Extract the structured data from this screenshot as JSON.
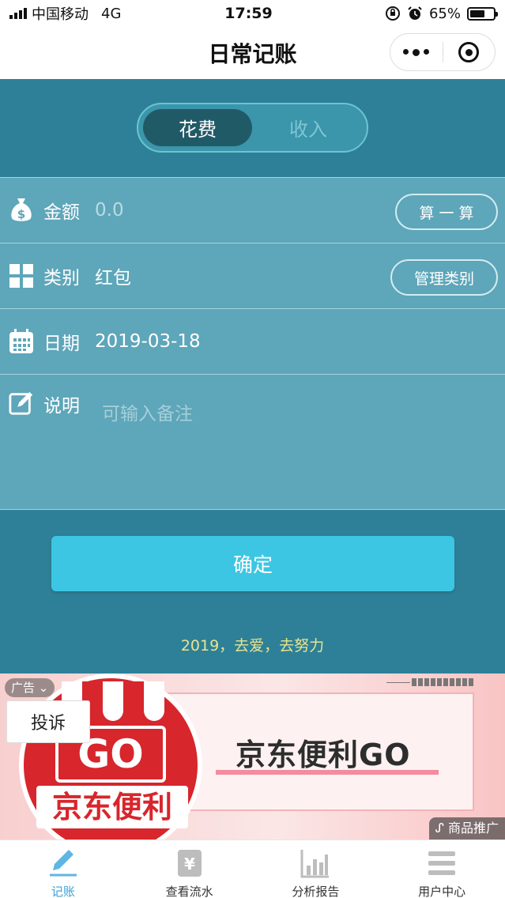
{
  "status_bar": {
    "carrier": "中国移动",
    "network": "4G",
    "time": "17:59",
    "battery": "65%",
    "battery_level": 0.65
  },
  "nav": {
    "title": "日常记账"
  },
  "toggle": {
    "active": "花费",
    "inactive": "收入"
  },
  "form": {
    "amount": {
      "label": "金额",
      "value": "0.0",
      "button": "算 一 算"
    },
    "category": {
      "label": "类别",
      "value": "红包",
      "button": "管理类别"
    },
    "date": {
      "label": "日期",
      "value": "2019-03-18"
    },
    "note": {
      "label": "说明",
      "placeholder": "可输入备注"
    }
  },
  "confirm_label": "确定",
  "slogan": "2019，去爱，去努力",
  "ad": {
    "tag": "广告",
    "complain": "投诉",
    "banner_text": "京东便利GO",
    "logo_go": "GO",
    "logo_cn": "京东便利",
    "promo": "商品推广"
  },
  "tabs": [
    {
      "label": "记账",
      "active": true
    },
    {
      "label": "查看流水",
      "active": false
    },
    {
      "label": "分析报告",
      "active": false
    },
    {
      "label": "用户中心",
      "active": false
    }
  ],
  "colors": {
    "primary": "#2e8098",
    "form_bg": "#5ea6b9",
    "confirm": "#3cc6e3",
    "slogan": "#e8e48f",
    "tab_active": "#3aa0d6"
  }
}
